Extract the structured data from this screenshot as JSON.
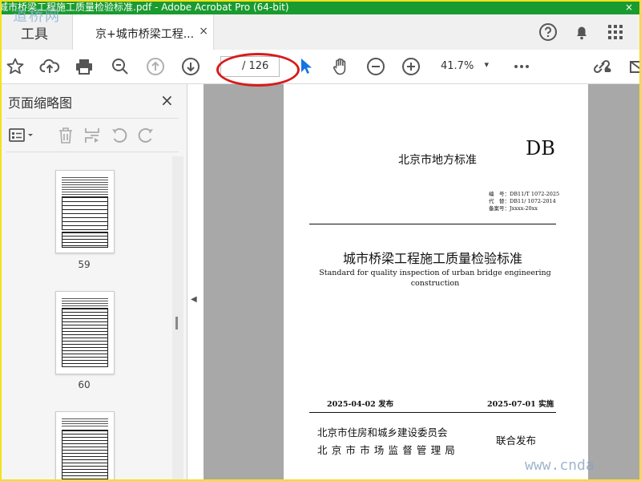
{
  "window": {
    "title": "城市桥梁工程施工质量检验标准.pdf - Adobe Acrobat Pro (64-bit)",
    "close_glyph": "×",
    "watermark_top": "道桥网",
    "watermark_bottom": "www.cnda"
  },
  "tabbar": {
    "tools_label": "工具",
    "document_tab_label": "京+城市桥梁工程...",
    "document_tab_close": "×",
    "right_icons": [
      "help-icon",
      "notification-bell-icon",
      "apps-grid-icon"
    ]
  },
  "toolbar": {
    "icons": [
      "star-icon",
      "upload-cloud-icon",
      "print-icon",
      "zoom-out-search-icon",
      "page-up-icon",
      "page-down-icon",
      "select-arrow-icon",
      "hand-tool-icon",
      "zoom-minus-icon",
      "zoom-plus-icon",
      "more-icon",
      "share-link-icon",
      "email-icon"
    ],
    "page_current": "",
    "page_total": "/ 126",
    "zoom_value": "41.7%",
    "zoom_dropdown": "▾",
    "accent": "#1473e6",
    "annotation_color": "#d61c1c"
  },
  "panel": {
    "title": "页面缩略图",
    "close_glyph": "×",
    "tools": [
      "thumbnail-options-icon",
      "delete-page-icon",
      "insert-page-icon",
      "rotate-ccw-icon",
      "rotate-cw-icon"
    ],
    "thumbnails": [
      {
        "page": "59"
      },
      {
        "page": "60"
      },
      {
        "page": ""
      }
    ],
    "collapse_glyph": "◀"
  },
  "document": {
    "standard_type": "北京市地方标准",
    "db_label": "DB",
    "code_lines": [
      "编　号：DB11/T 1072-2025",
      "代　替：DB11/ 1072-2014",
      "备案号：Jxxxx-20xx"
    ],
    "title_cn": "城市桥梁工程施工质量检验标准",
    "title_en_line1": "Standard for quality inspection of urban bridge engineering",
    "title_en_line2": "construction",
    "publish_date": "2025-04-02 发布",
    "effective_date": "2025-07-01 实施",
    "issuer_1": "北京市住房和城乡建设委员会",
    "issuer_2": "北京市市场监督管理局",
    "joint_issue": "联合发布"
  }
}
